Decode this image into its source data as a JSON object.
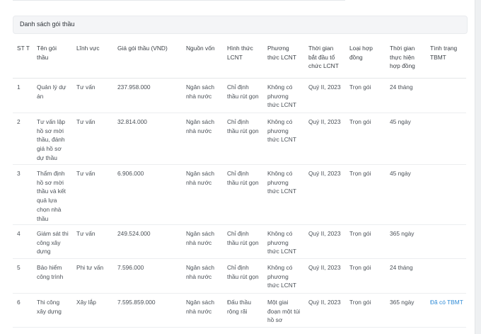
{
  "panel": {
    "title": "Danh sách gói thầu"
  },
  "columns": [
    "ST T",
    "Tên gói thầu",
    "Lĩnh vực",
    "Giá gói thầu (VND)",
    "Nguồn vốn",
    "Hình thức LCNT",
    "Phương thức LCNT",
    "Thời gian bắt đầu tổ chức LCNT",
    "Loại hợp đồng",
    "Thời gian thực hiện hợp đồng",
    "Tình trạng TBMT"
  ],
  "rows": [
    [
      "1",
      "Quản lý dự án",
      "Tư vấn",
      "237.958.000",
      "Ngân sách nhà nước",
      "Chỉ định thầu rút gọn",
      "Không có phương thức LCNT",
      "Quý II, 2023",
      "Trọn gói",
      "24 tháng",
      ""
    ],
    [
      "2",
      "Tư vấn lập hồ sơ mời thầu, đánh giá hồ sơ dự thầu",
      "Tư vấn",
      "32.814.000",
      "Ngân sách nhà nước",
      "Chỉ định thầu rút gọn",
      "Không có phương thức LCNT",
      "Quý II, 2023",
      "Trọn gói",
      "45 ngày",
      ""
    ],
    [
      "3",
      "Thẩm định hồ sơ mời thầu và kết quả lựa chọn nhà thầu",
      "Tư vấn",
      "6.906.000",
      "Ngân sách nhà nước",
      "Chỉ định thầu rút gọn",
      "Không có phương thức LCNT",
      "Quý II, 2023",
      "Trọn gói",
      "45 ngày",
      ""
    ],
    [
      "4",
      "Giám sát thi công xây dựng",
      "Tư vấn",
      "249.524.000",
      "Ngân sách nhà nước",
      "Chỉ định thầu rút gọn",
      "Không có phương thức LCNT",
      "Quý II, 2023",
      "Trọn gói",
      "365 ngày",
      ""
    ],
    [
      "5",
      "Bảo hiểm công trình",
      "Phi tư vấn",
      "7.596.000",
      "Ngân sách nhà nước",
      "Chỉ định thầu rút gọn",
      "Không có phương thức LCNT",
      "Quý II, 2023",
      "Trọn gói",
      "24 tháng",
      ""
    ],
    [
      "6",
      "Thi công xây dựng",
      "Xây lắp",
      "7.595.859.000",
      "Ngân sách nhà nước",
      "Đấu thầu rộng rãi",
      "Một giai đoạn một túi hồ sơ",
      "Quý II, 2023",
      "Trọn gói",
      "365 ngày",
      "Đã có TBMT"
    ]
  ]
}
